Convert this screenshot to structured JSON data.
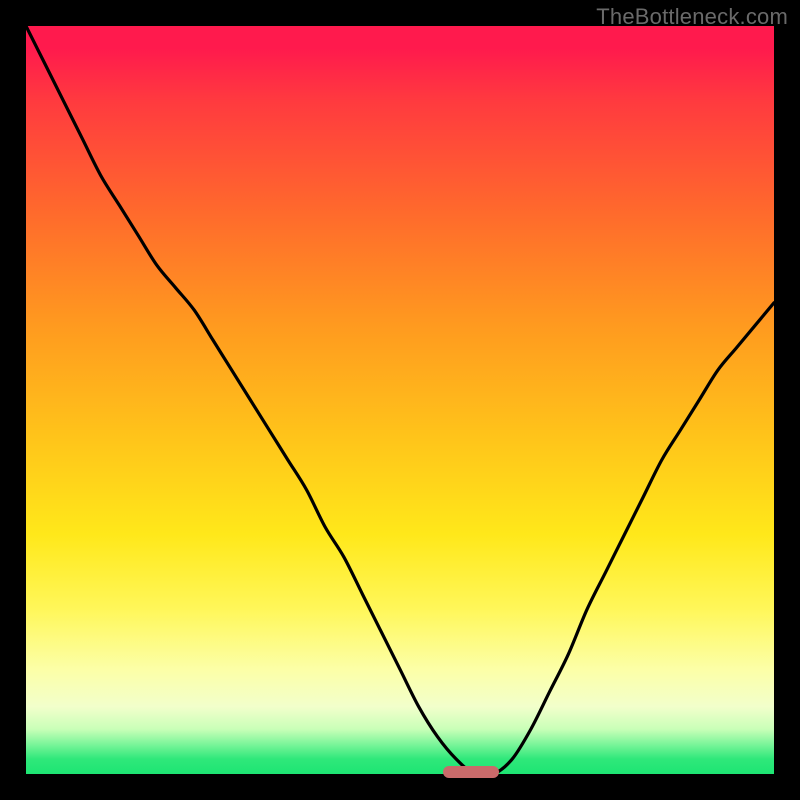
{
  "watermark": "TheBottleneck.com",
  "chart_data": {
    "type": "line",
    "title": "",
    "xlabel": "",
    "ylabel": "",
    "x": [
      0.0,
      0.025,
      0.05,
      0.075,
      0.1,
      0.125,
      0.15,
      0.175,
      0.2,
      0.225,
      0.25,
      0.275,
      0.3,
      0.325,
      0.35,
      0.375,
      0.4,
      0.425,
      0.45,
      0.475,
      0.5,
      0.525,
      0.55,
      0.575,
      0.6,
      0.625,
      0.65,
      0.675,
      0.7,
      0.725,
      0.75,
      0.775,
      0.8,
      0.825,
      0.85,
      0.875,
      0.9,
      0.925,
      0.95,
      0.975,
      1.0
    ],
    "values": [
      100,
      95,
      90,
      85,
      80,
      76,
      72,
      68,
      65,
      62,
      58,
      54,
      50,
      46,
      42,
      38,
      33,
      29,
      24,
      19,
      14,
      9,
      5,
      2,
      0,
      0,
      2,
      6,
      11,
      16,
      22,
      27,
      32,
      37,
      42,
      46,
      50,
      54,
      57,
      60,
      63
    ],
    "ylim": [
      0,
      100
    ],
    "xlim": [
      0,
      1
    ],
    "gradient_stops": [
      {
        "pos": 0.0,
        "color": "#ff1a4d"
      },
      {
        "pos": 0.4,
        "color": "#ff9a1f"
      },
      {
        "pos": 0.68,
        "color": "#ffe81a"
      },
      {
        "pos": 0.91,
        "color": "#f2ffcb"
      },
      {
        "pos": 1.0,
        "color": "#1de573"
      }
    ],
    "marker": {
      "x_center": 0.595,
      "width": 0.075
    }
  }
}
